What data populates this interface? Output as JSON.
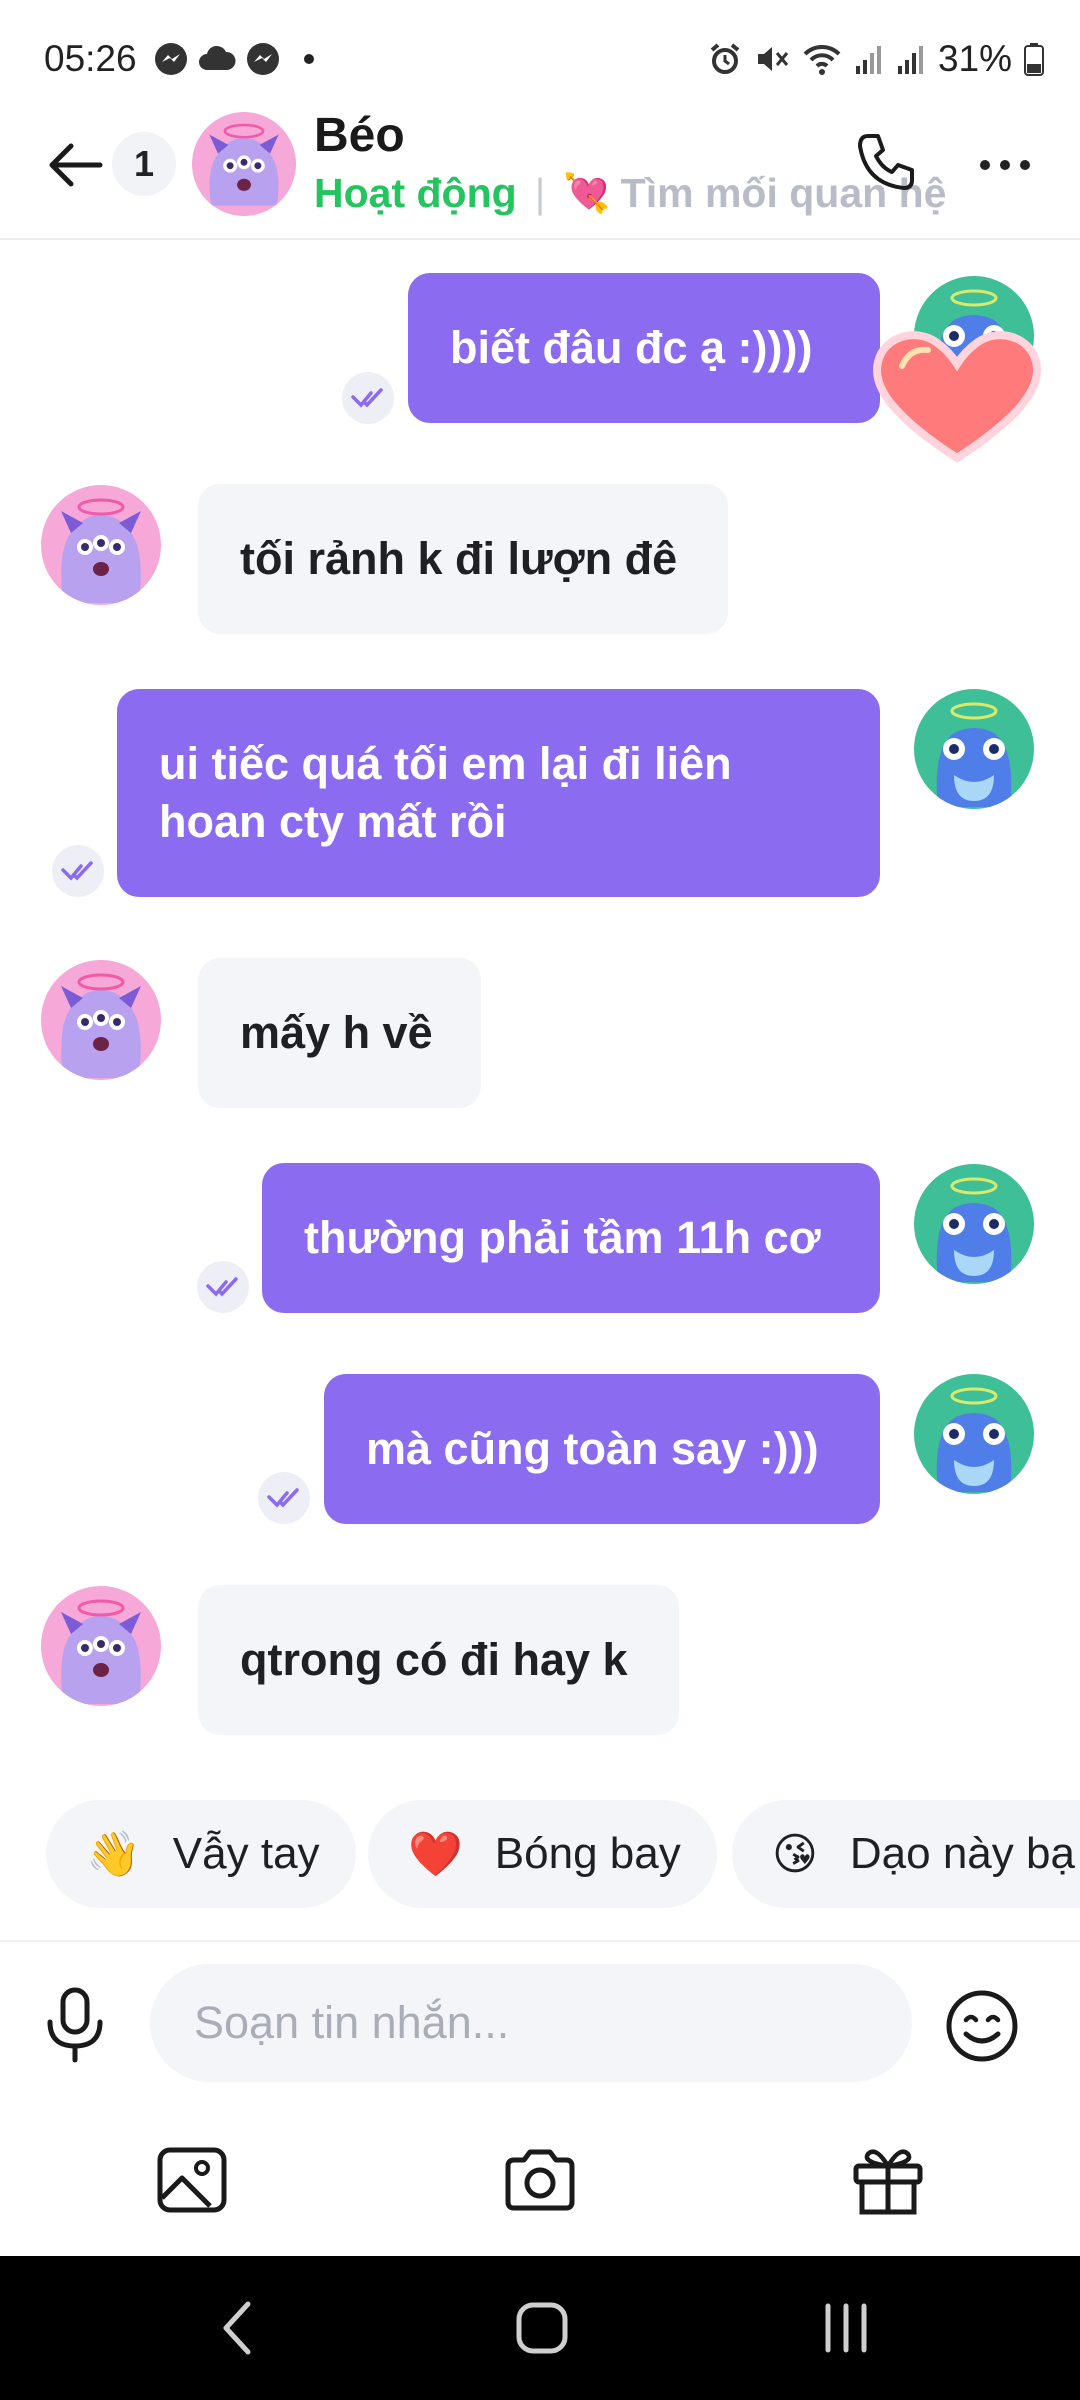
{
  "status_bar": {
    "time": "05:26",
    "battery": "31%",
    "left_icons": [
      "messenger-icon",
      "cloud-icon",
      "messenger-icon",
      "dot-icon"
    ],
    "right_icons": [
      "alarm-icon",
      "mute-icon",
      "wifi-icon",
      "signal-icon",
      "signal-icon",
      "battery-icon"
    ]
  },
  "header": {
    "back_count": "1",
    "name": "Béo",
    "status": "Hoạt động",
    "separator": "|",
    "relation_emoji": "💘",
    "relation_label": "Tìm mối quan hệ"
  },
  "messages": [
    {
      "dir": "out",
      "text": "biết đâu đc ạ :))))"
    },
    {
      "dir": "in",
      "text": "tối rảnh k đi lượn đê"
    },
    {
      "dir": "out",
      "text": "ui tiếc quá tối em lại đi liên hoan cty mất rồi"
    },
    {
      "dir": "in",
      "text": "mấy h về"
    },
    {
      "dir": "out",
      "text": "thường phải tầm 11h cơ"
    },
    {
      "dir": "out",
      "text": "mà cũng toàn say :)))"
    },
    {
      "dir": "in",
      "text": "qtrong có đi hay k"
    }
  ],
  "quick_replies": [
    {
      "emoji": "👋",
      "label": "Vẫy tay"
    },
    {
      "emoji": "❤️",
      "label": "Bóng bay"
    },
    {
      "emoji": "😘",
      "label": "Dạo này bạ"
    }
  ],
  "composer": {
    "placeholder": "Soạn tin nhắn..."
  },
  "toolbar": [
    "image-icon",
    "camera-icon",
    "gift-icon"
  ],
  "colors": {
    "accent": "#8b6cf0",
    "online": "#22c55e",
    "incoming_bubble": "#f4f5f8"
  }
}
